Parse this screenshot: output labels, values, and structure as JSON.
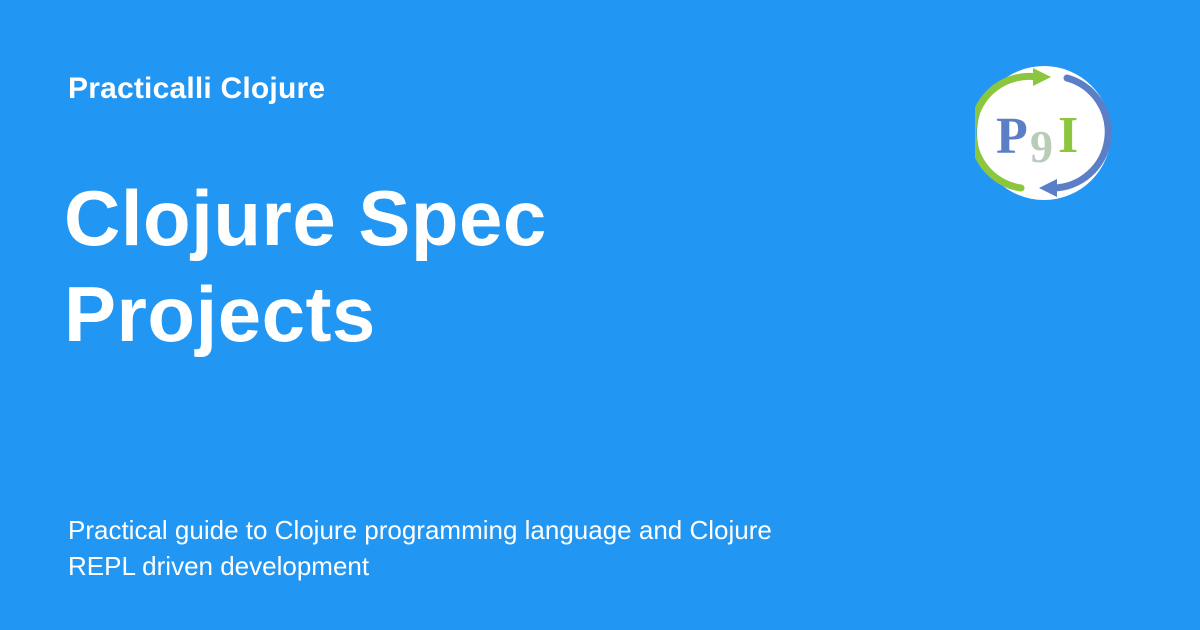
{
  "site": {
    "name": "Practicalli Clojure"
  },
  "page": {
    "title_lines": [
      "Clojure Spec",
      "Projects"
    ],
    "description_lines": [
      "Practical guide to Clojure programming language and Clojure",
      "REPL driven development"
    ]
  },
  "logo": {
    "icon": "practicalli-logo-icon",
    "letters": {
      "p": "P",
      "g": "9",
      "i": "I"
    }
  },
  "colors": {
    "background": "#2196f3",
    "text": "#ffffff",
    "logo_blue": "#5b7fc7",
    "logo_green": "#8cc63f",
    "logo_grey": "#b8ccb8"
  }
}
